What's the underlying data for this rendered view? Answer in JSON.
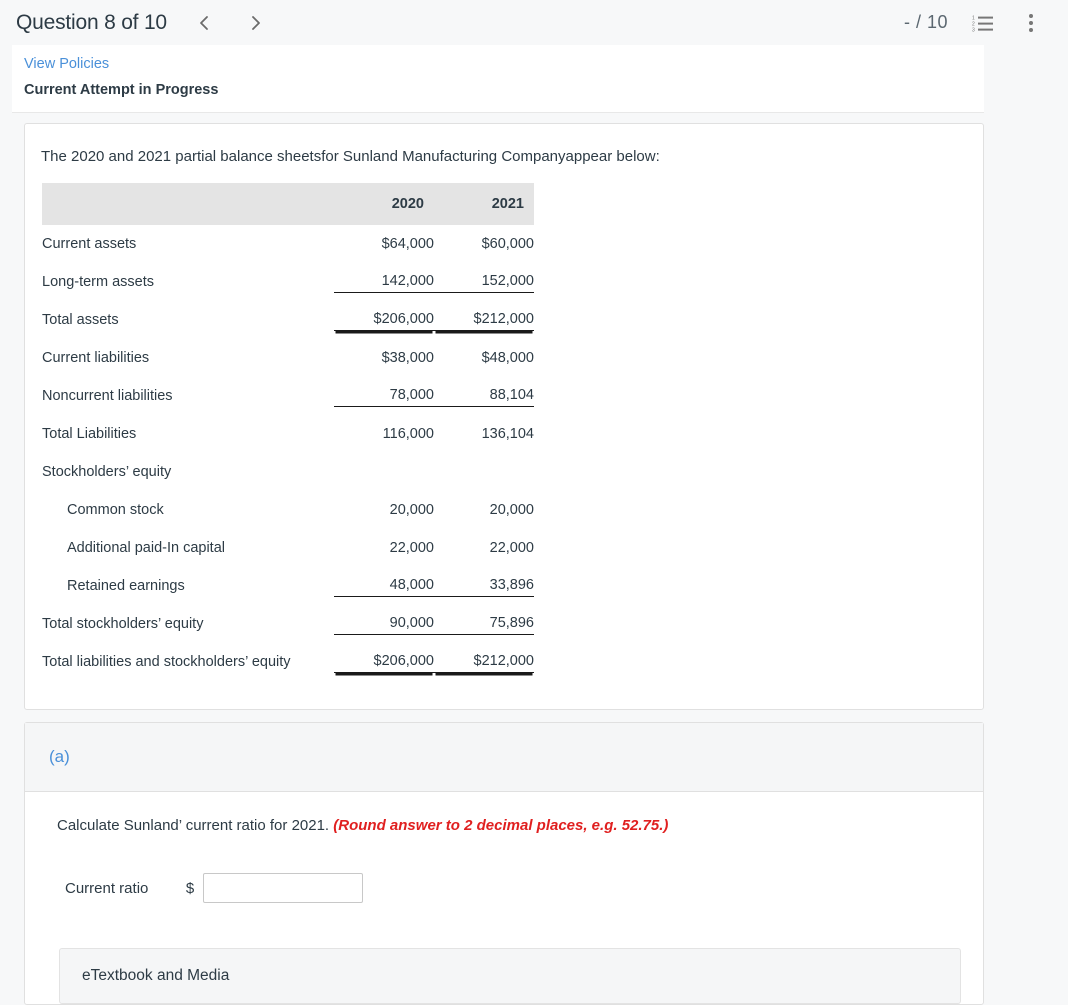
{
  "header": {
    "question_title": "Question 8 of 10",
    "prev_icon": "chevron-left-icon",
    "next_icon": "chevron-right-icon",
    "score": "- / 10",
    "list_icon": "numbered-list-icon",
    "menu_icon": "vertical-dots-icon"
  },
  "attempt": {
    "policies_link": "View Policies",
    "status": "Current Attempt in Progress"
  },
  "problem": {
    "intro": "The 2020 and 2021 partial balance sheetsfor Sunland Manufacturing Companyappear below:"
  },
  "chart_data": {
    "type": "table",
    "title": "Sunland Manufacturing Company partial balance sheets",
    "columns": [
      "",
      "2020",
      "2021"
    ],
    "rows": [
      {
        "label": "Current assets",
        "indent": false,
        "v2020": "$64,000",
        "v2021": "$60,000",
        "rule2020": "none",
        "rule2021": "none"
      },
      {
        "label": "Long-term assets",
        "indent": false,
        "v2020": "142,000",
        "v2021": "152,000",
        "rule2020": "bottom",
        "rule2021": "bottom"
      },
      {
        "label": "Total assets",
        "indent": false,
        "v2020": "$206,000",
        "v2021": "$212,000",
        "rule2020": "double",
        "rule2021": "double"
      },
      {
        "label": "Current liabilities",
        "indent": false,
        "v2020": "$38,000",
        "v2021": "$48,000",
        "rule2020": "none",
        "rule2021": "none"
      },
      {
        "label": "Noncurrent liabilities",
        "indent": false,
        "v2020": "78,000",
        "v2021": "88,104",
        "rule2020": "bottom",
        "rule2021": "bottom"
      },
      {
        "label": "Total Liabilities",
        "indent": false,
        "v2020": "116,000",
        "v2021": "136,104",
        "rule2020": "none",
        "rule2021": "none"
      },
      {
        "label": "Stockholders’ equity",
        "indent": false,
        "v2020": "",
        "v2021": "",
        "rule2020": "none",
        "rule2021": "none"
      },
      {
        "label": "Common stock",
        "indent": true,
        "v2020": "20,000",
        "v2021": "20,000",
        "rule2020": "none",
        "rule2021": "none"
      },
      {
        "label": "Additional paid-In capital",
        "indent": true,
        "v2020": "22,000",
        "v2021": "22,000",
        "rule2020": "none",
        "rule2021": "none"
      },
      {
        "label": "Retained earnings",
        "indent": true,
        "v2020": "48,000",
        "v2021": "33,896",
        "rule2020": "bottom",
        "rule2021": "bottom"
      },
      {
        "label": "Total stockholders’ equity",
        "indent": false,
        "v2020": "90,000",
        "v2021": "75,896",
        "rule2020": "bottom",
        "rule2021": "bottom"
      },
      {
        "label": "Total liabilities and stockholders’ equity",
        "indent": false,
        "v2020": "$206,000",
        "v2021": "$212,000",
        "rule2020": "double",
        "rule2021": "double"
      }
    ],
    "numeric": {
      "2020": {
        "current_assets": 64000,
        "long_term_assets": 142000,
        "total_assets": 206000,
        "current_liabilities": 38000,
        "noncurrent_liabilities": 78000,
        "total_liabilities": 116000,
        "common_stock": 20000,
        "additional_paid_in_capital": 22000,
        "retained_earnings": 48000,
        "total_stockholders_equity": 90000,
        "total_liabilities_and_equity": 206000
      },
      "2021": {
        "current_assets": 60000,
        "long_term_assets": 152000,
        "total_assets": 212000,
        "current_liabilities": 48000,
        "noncurrent_liabilities": 88104,
        "total_liabilities": 136104,
        "common_stock": 20000,
        "additional_paid_in_capital": 22000,
        "retained_earnings": 33896,
        "total_stockholders_equity": 75896,
        "total_liabilities_and_equity": 212000
      }
    }
  },
  "part_a": {
    "label": "(a)",
    "question": "Calculate Sunland’ current ratio for 2021. ",
    "hint": "(Round answer to 2 decimal places, e.g. 52.75.)",
    "answer_label": "Current ratio",
    "currency_symbol": "$",
    "answer_value": "",
    "answer_placeholder": ""
  },
  "footer": {
    "etextbook": "eTextbook and Media"
  },
  "colors": {
    "link": "#4a90d9",
    "hint": "#e02020",
    "text": "#2d3b45",
    "table_header_bg": "#e4e4e4",
    "page_bg": "#f7f8f9"
  }
}
